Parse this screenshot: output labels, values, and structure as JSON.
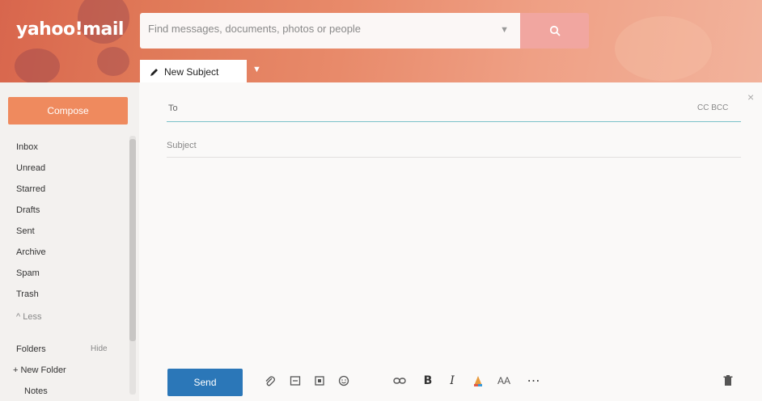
{
  "app": {
    "logo": "yahoo!mail"
  },
  "search": {
    "placeholder": "Find messages, documents, photos or people"
  },
  "tab": {
    "label": "New Subject"
  },
  "sidebar": {
    "compose_label": "Compose",
    "items": [
      {
        "label": "Inbox"
      },
      {
        "label": "Unread"
      },
      {
        "label": "Starred"
      },
      {
        "label": "Drafts"
      },
      {
        "label": "Sent"
      },
      {
        "label": "Archive"
      },
      {
        "label": "Spam"
      },
      {
        "label": "Trash"
      }
    ],
    "less_label": "^ Less",
    "folders_label": "Folders",
    "hide_label": "Hide",
    "new_folder_label": "+ New Folder",
    "notes_label": "Notes"
  },
  "compose": {
    "to_label": "To",
    "cc_bcc_label": "CC BCC",
    "subject_placeholder": "Subject",
    "send_label": "Send"
  },
  "toolbar": {
    "icons": [
      "attach-icon",
      "insert-file-icon",
      "sticker-icon",
      "emoji-icon",
      "link-icon",
      "bold-icon",
      "italic-icon",
      "text-color-icon",
      "font-size-icon",
      "more-icon",
      "delete-icon"
    ]
  },
  "colors": {
    "accent": "#2b77b8",
    "compose": "#ef8a5e",
    "header": "#e07958"
  }
}
